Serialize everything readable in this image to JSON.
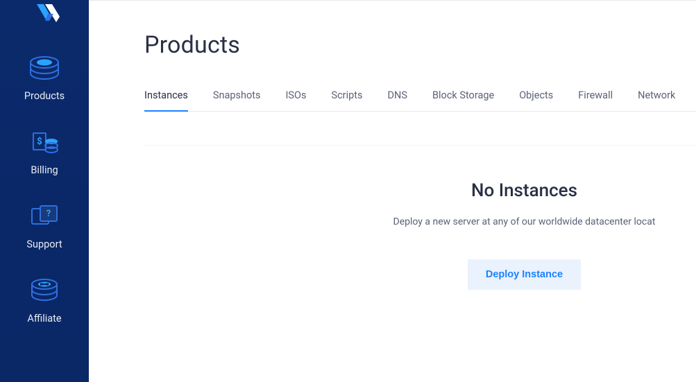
{
  "sidebar": {
    "items": [
      {
        "label": "Products"
      },
      {
        "label": "Billing"
      },
      {
        "label": "Support"
      },
      {
        "label": "Affiliate"
      }
    ]
  },
  "page": {
    "title": "Products"
  },
  "tabs": [
    {
      "label": "Instances",
      "active": true
    },
    {
      "label": "Snapshots"
    },
    {
      "label": "ISOs"
    },
    {
      "label": "Scripts"
    },
    {
      "label": "DNS"
    },
    {
      "label": "Block Storage"
    },
    {
      "label": "Objects"
    },
    {
      "label": "Firewall"
    },
    {
      "label": "Network"
    }
  ],
  "empty_state": {
    "title": "No Instances",
    "subtitle": "Deploy a new server at any of our worldwide datacenter locat",
    "button_label": "Deploy Instance"
  },
  "colors": {
    "sidebar_bg": "#0b2a6b",
    "accent": "#1a82ff",
    "icon_blue": "#2f6fe0",
    "icon_highlight": "#2aa3ff"
  }
}
